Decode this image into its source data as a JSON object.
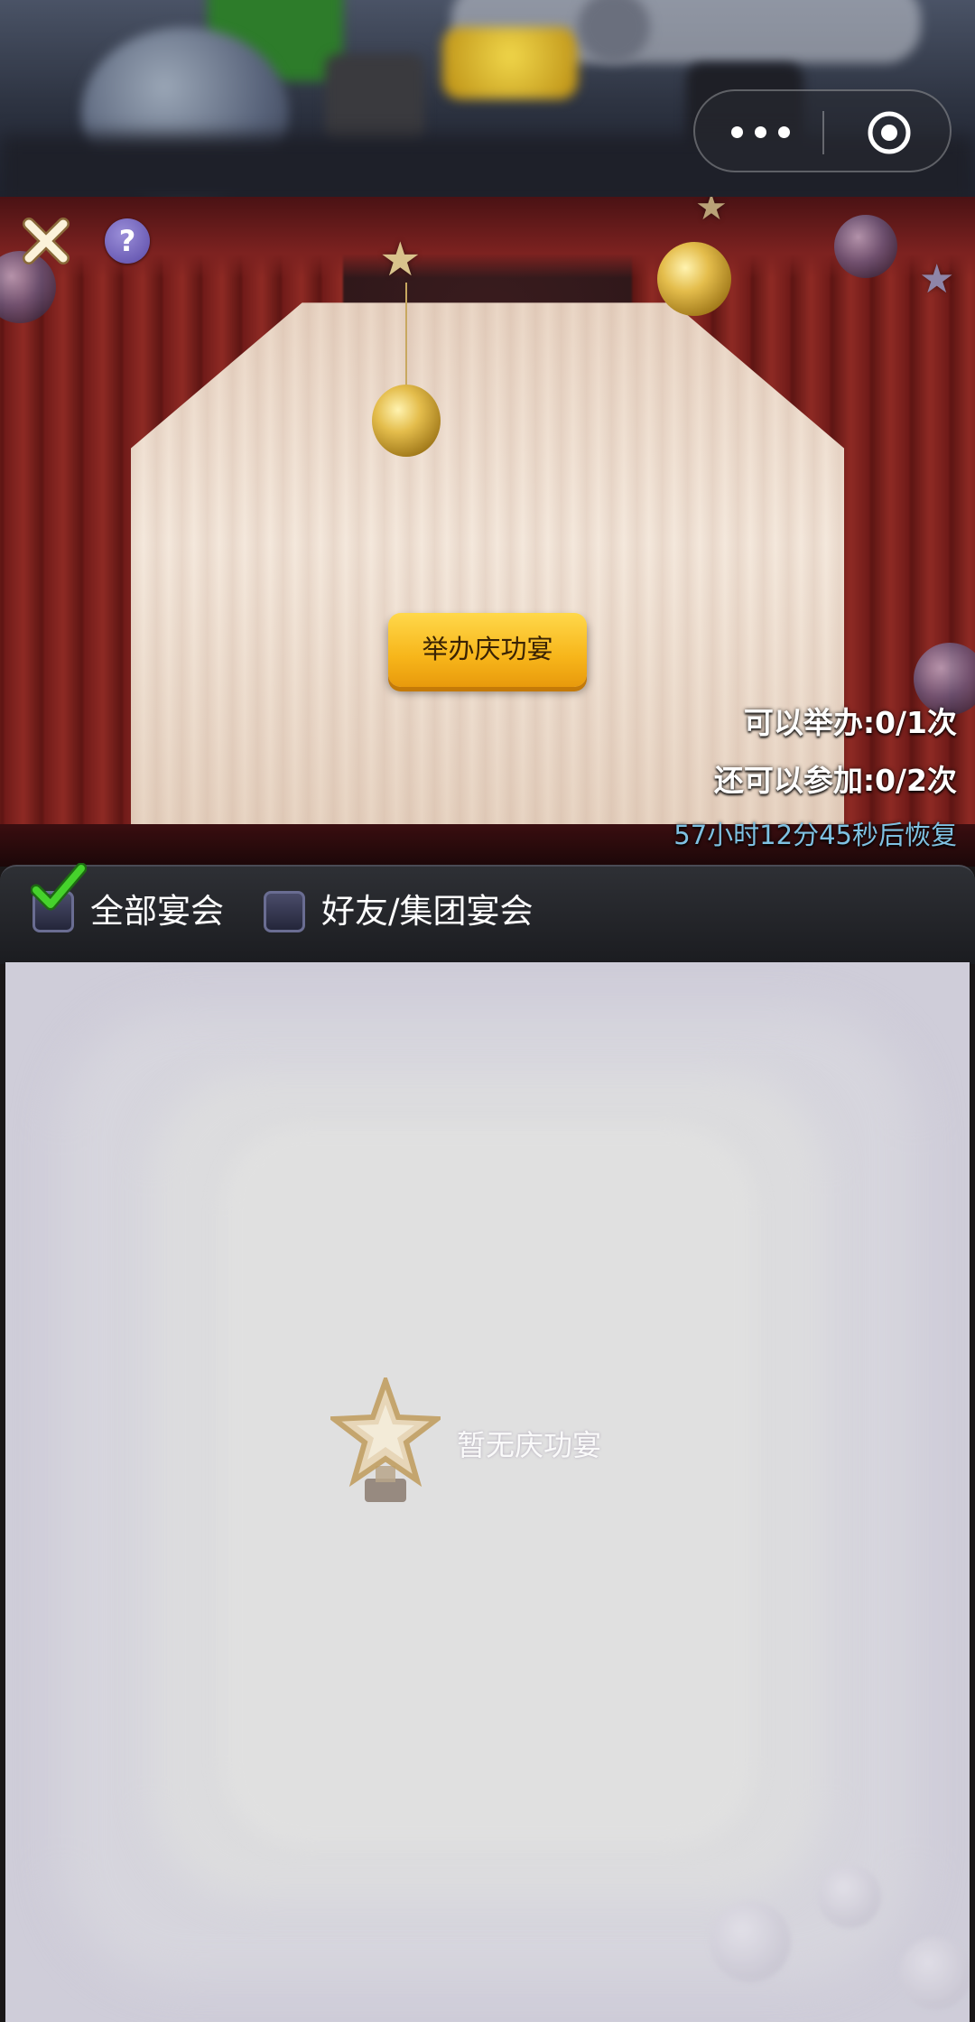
{
  "capsule": {
    "more_icon": "more-dots-icon",
    "close_icon": "target-circle-icon"
  },
  "header": {
    "close_icon": "close-x-icon",
    "help_label": "?"
  },
  "stage": {
    "host_button_label": "举办庆功宴",
    "host_count_text": "可以举办:0/1次",
    "join_count_text": "还可以参加:0/2次",
    "recover_text": "57小时12分45秒后恢复"
  },
  "filters": {
    "all": {
      "label": "全部宴会",
      "checked": true
    },
    "friends": {
      "label": "好友/集团宴会",
      "checked": false
    }
  },
  "list": {
    "empty_text": "暂无庆功宴",
    "empty_icon": "trophy-star-icon"
  },
  "colors": {
    "button_gold": "#f7b51a",
    "recover_blue": "#7fc1e2",
    "check_green": "#3fcf2a"
  }
}
